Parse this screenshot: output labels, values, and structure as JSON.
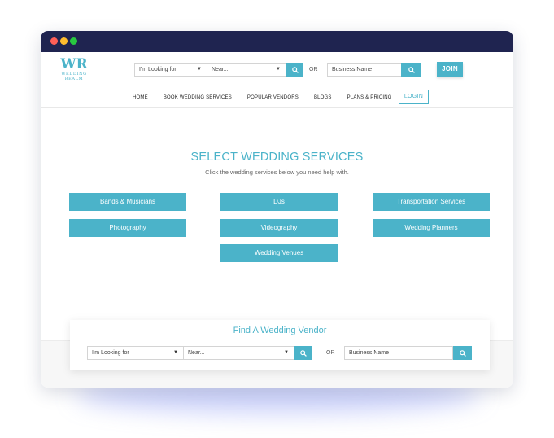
{
  "logo": {
    "mark": "WR",
    "line1": "WEDDING",
    "line2": "REALM"
  },
  "header": {
    "looking_for": "I'm Looking for",
    "near": "Near...",
    "or_label": "OR",
    "business_name": "Business Name",
    "join_label": "JOIN"
  },
  "nav": {
    "items": [
      "HOME",
      "BOOK WEDDING SERVICES",
      "POPULAR VENDORS",
      "BLOGS",
      "PLANS & PRICING"
    ],
    "login_label": "LOGIN"
  },
  "main": {
    "title": "SELECT WEDDING SERVICES",
    "subtitle": "Click the wedding services below you need help with.",
    "services": [
      "Bands & Musicians",
      "DJs",
      "Transportation Services",
      "Photography",
      "Videography",
      "Wedding Planners",
      "Wedding Venues"
    ]
  },
  "finder": {
    "title": "Find A Wedding Vendor",
    "looking_for": "I'm Looking for",
    "near": "Near...",
    "or_label": "OR",
    "business_name": "Business Name"
  },
  "icons": {
    "search": "search-icon",
    "dropdown": "chevron-down-icon"
  },
  "colors": {
    "accent": "#4bb3c9",
    "titlebar": "#1f2450"
  }
}
